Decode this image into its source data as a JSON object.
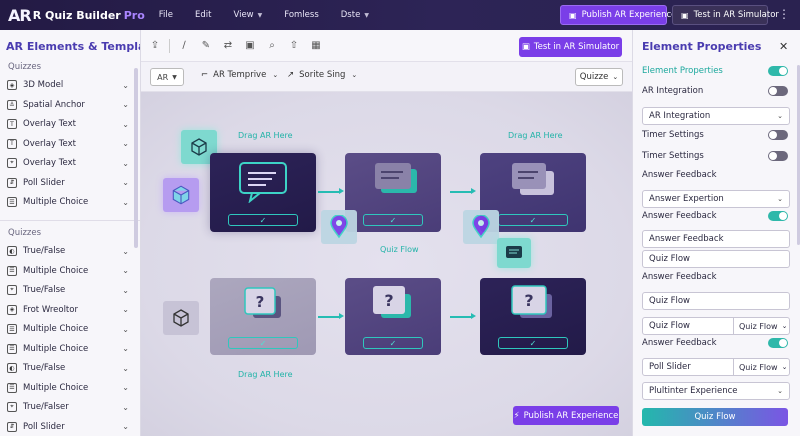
{
  "app": {
    "logo_mark": "AR",
    "title": "R Quiz Builder",
    "title_suffix": "Pro"
  },
  "menu": [
    {
      "label": "File",
      "caret": false
    },
    {
      "label": "Edit",
      "caret": false
    },
    {
      "label": "View",
      "caret": true
    },
    {
      "label": "Fomless",
      "caret": false
    },
    {
      "label": "Dste",
      "caret": true
    }
  ],
  "topbar": {
    "publish_label": "Publish AR Experience",
    "test_label": "Test in AR Simulator"
  },
  "left_panel": {
    "title": "AR Elements & Templates",
    "section1": "Quizzes",
    "items1": [
      {
        "label": "3D Model",
        "icon": "cube-icon"
      },
      {
        "label": "Spatial Anchor",
        "icon": "anchor-icon"
      },
      {
        "label": "Overlay Text",
        "icon": "text-icon"
      },
      {
        "label": "Overlay Text",
        "icon": "text-icon"
      },
      {
        "label": "Overlay Text",
        "icon": "pin-icon"
      },
      {
        "label": "Poll Slider",
        "icon": "slider-icon"
      },
      {
        "label": "Multiple Choice",
        "icon": "list-icon"
      }
    ],
    "section2": "Quizzes",
    "items2": [
      {
        "label": "True/False",
        "icon": "toggle-icon"
      },
      {
        "label": "Multiple Choice",
        "icon": "list-icon"
      },
      {
        "label": "True/False",
        "icon": "pin-icon"
      },
      {
        "label": "Frot Wreoltor",
        "icon": "cube-icon"
      },
      {
        "label": "Multiple Choice",
        "icon": "list-icon"
      },
      {
        "label": "Multiple Choice",
        "icon": "list-icon"
      },
      {
        "label": "True/False",
        "icon": "toggle-icon"
      },
      {
        "label": "Multiple Choice",
        "icon": "list-icon"
      },
      {
        "label": "True/Falser",
        "icon": "pin-icon"
      },
      {
        "label": "Poll Slider",
        "icon": "slider-icon"
      }
    ]
  },
  "toolbar": {
    "sim_label": "Test in AR Simulator"
  },
  "row2": {
    "ar_label": "AR",
    "template_label": "AR Temprive",
    "sprite_label": "Sorite Sing",
    "quiz_label": "Quizze"
  },
  "canvas": {
    "drag_label_1": "Drag AR Here",
    "drag_label_2": "Drag AR Here",
    "drag_label_3": "Drag AR Here",
    "flow_label": "Quiz Flow",
    "publish_label": "Publish AR Experience"
  },
  "right_panel": {
    "title": "Element Properties",
    "rows": [
      {
        "type": "toggle",
        "label": "Element Properties",
        "on": true,
        "teal": true
      },
      {
        "type": "toggle",
        "label": "AR Integration",
        "on": false
      },
      {
        "type": "select",
        "value": "AR Integration"
      },
      {
        "type": "toggle",
        "label": "Timer Settings",
        "on": false
      },
      {
        "type": "toggle",
        "label": "Timer Settings",
        "on": false
      },
      {
        "type": "label",
        "label": "Answer Feedback"
      },
      {
        "type": "select",
        "value": "Answer Expertion"
      },
      {
        "type": "toggle",
        "label": "Answer Feedback",
        "on": true
      },
      {
        "type": "field",
        "value": "Answer Feedback"
      },
      {
        "type": "field",
        "value": "Quiz Flow"
      },
      {
        "type": "label",
        "label": "Answer Feedback"
      },
      {
        "type": "field",
        "value": "Quiz Flow"
      },
      {
        "type": "split",
        "value": "Quiz Flow",
        "sub": "Quiz Flow"
      },
      {
        "type": "toggle",
        "label": "Answer Feedback",
        "on": true
      },
      {
        "type": "split",
        "value": "Poll Slider",
        "sub": "Quiz Flow"
      },
      {
        "type": "select",
        "value": "Plultinter Experience"
      }
    ],
    "button": "Quiz Flow"
  }
}
